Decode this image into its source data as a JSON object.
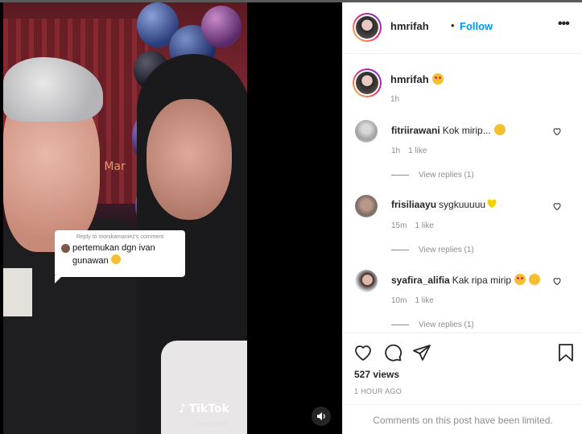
{
  "video": {
    "bubble_reply": "Reply to monikamaniez's comment",
    "bubble_text": "pertemukan dgn ivan gunawan",
    "watermark_brand": "TikTok",
    "watermark_user": "@hmrifah",
    "neon_text": "n Mar"
  },
  "header": {
    "username": "hmrifah",
    "separator": "•",
    "follow_label": "Follow",
    "more_label": "•••"
  },
  "caption": {
    "username": "hmrifah",
    "time": "1h"
  },
  "comments": [
    {
      "username": "fitriirawani",
      "text": "Kok mirip...",
      "time": "1h",
      "likes": "1 like",
      "replies": "View replies (1)"
    },
    {
      "username": "frisiliaayu",
      "text": "sygkuuuuu",
      "time": "15m",
      "likes": "1 like",
      "replies": "View replies (1)"
    },
    {
      "username": "syafira_alifia",
      "text": "Kak ripa mirip",
      "time": "10m",
      "likes": "1 like",
      "replies": "View replies (1)"
    }
  ],
  "stats": {
    "views": "527 views",
    "posted": "1 HOUR AGO"
  },
  "footer": {
    "limited": "Comments on this post have been limited."
  },
  "colors": {
    "accent": "#0095f6",
    "muted": "#8e8e8e",
    "text": "#262626"
  }
}
